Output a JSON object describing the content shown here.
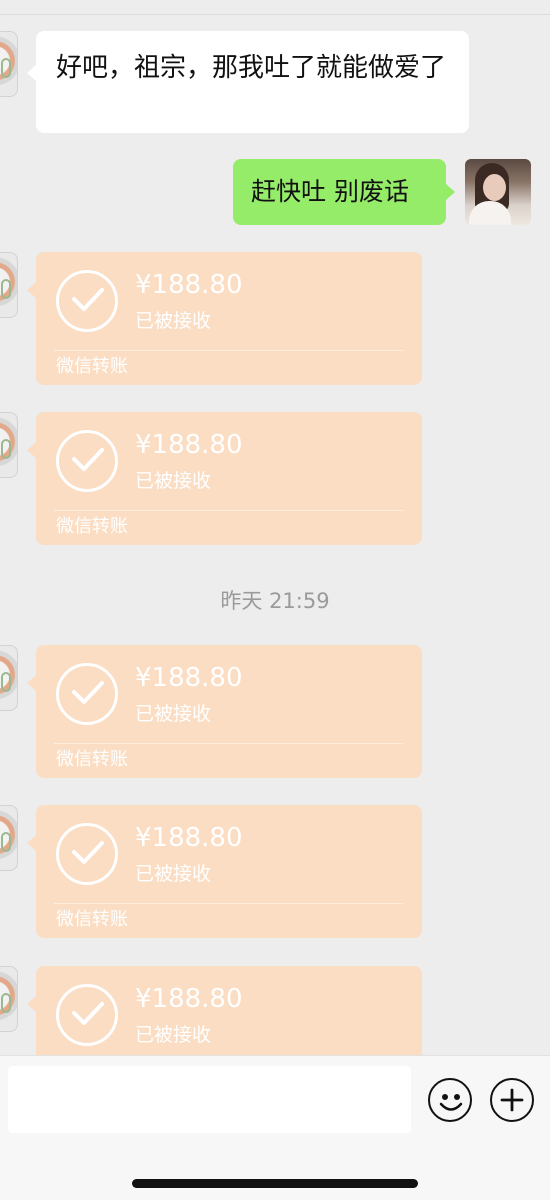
{
  "conversation": {
    "messages": [
      {
        "side": "left",
        "type": "text",
        "text": "好吧，祖宗，那我吐了就能做爱了"
      },
      {
        "side": "right",
        "type": "text",
        "text": "赶快吐 别废话"
      }
    ],
    "transfers": [
      {
        "amount": "¥188.80",
        "status": "已被接收",
        "service": "微信转账"
      },
      {
        "amount": "¥188.80",
        "status": "已被接收",
        "service": "微信转账"
      },
      {
        "amount": "¥188.80",
        "status": "已被接收",
        "service": "微信转账"
      },
      {
        "amount": "¥188.80",
        "status": "已被接收",
        "service": "微信转账"
      },
      {
        "amount": "¥188.80",
        "status": "已被接收"
      }
    ],
    "timestamp": "昨天 21:59"
  },
  "composer": {
    "value": "",
    "emoji_icon": "smiley-icon",
    "plus_icon": "plus-circle-icon"
  },
  "colors": {
    "background": "#ededed",
    "sent_bubble": "#95ec69",
    "received_bubble": "#ffffff",
    "transfer_card": "#fbddc3"
  }
}
